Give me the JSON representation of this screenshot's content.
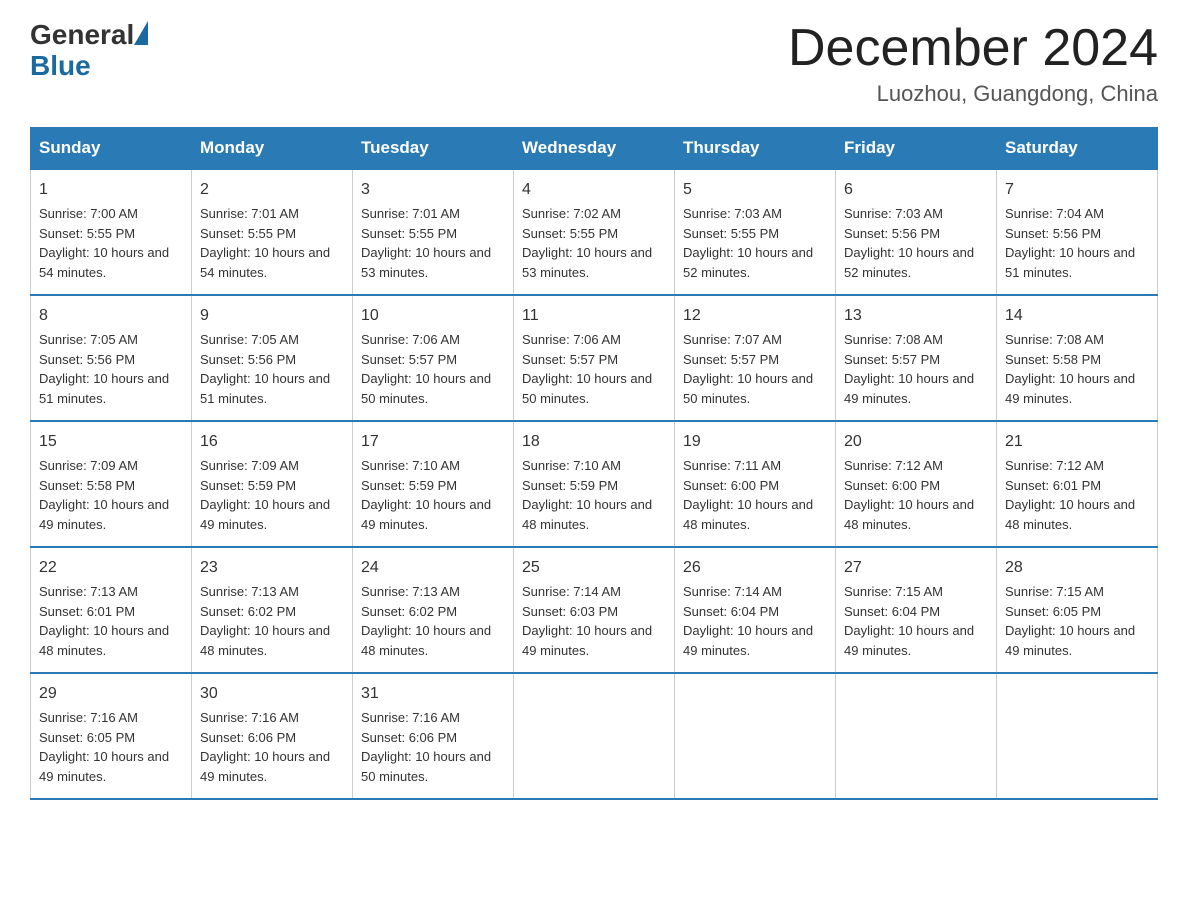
{
  "header": {
    "logo_general": "General",
    "logo_blue": "Blue",
    "month_title": "December 2024",
    "location": "Luozhou, Guangdong, China"
  },
  "days_of_week": [
    "Sunday",
    "Monday",
    "Tuesday",
    "Wednesday",
    "Thursday",
    "Friday",
    "Saturday"
  ],
  "weeks": [
    [
      {
        "day": "1",
        "sunrise": "7:00 AM",
        "sunset": "5:55 PM",
        "daylight": "10 hours and 54 minutes."
      },
      {
        "day": "2",
        "sunrise": "7:01 AM",
        "sunset": "5:55 PM",
        "daylight": "10 hours and 54 minutes."
      },
      {
        "day": "3",
        "sunrise": "7:01 AM",
        "sunset": "5:55 PM",
        "daylight": "10 hours and 53 minutes."
      },
      {
        "day": "4",
        "sunrise": "7:02 AM",
        "sunset": "5:55 PM",
        "daylight": "10 hours and 53 minutes."
      },
      {
        "day": "5",
        "sunrise": "7:03 AM",
        "sunset": "5:55 PM",
        "daylight": "10 hours and 52 minutes."
      },
      {
        "day": "6",
        "sunrise": "7:03 AM",
        "sunset": "5:56 PM",
        "daylight": "10 hours and 52 minutes."
      },
      {
        "day": "7",
        "sunrise": "7:04 AM",
        "sunset": "5:56 PM",
        "daylight": "10 hours and 51 minutes."
      }
    ],
    [
      {
        "day": "8",
        "sunrise": "7:05 AM",
        "sunset": "5:56 PM",
        "daylight": "10 hours and 51 minutes."
      },
      {
        "day": "9",
        "sunrise": "7:05 AM",
        "sunset": "5:56 PM",
        "daylight": "10 hours and 51 minutes."
      },
      {
        "day": "10",
        "sunrise": "7:06 AM",
        "sunset": "5:57 PM",
        "daylight": "10 hours and 50 minutes."
      },
      {
        "day": "11",
        "sunrise": "7:06 AM",
        "sunset": "5:57 PM",
        "daylight": "10 hours and 50 minutes."
      },
      {
        "day": "12",
        "sunrise": "7:07 AM",
        "sunset": "5:57 PM",
        "daylight": "10 hours and 50 minutes."
      },
      {
        "day": "13",
        "sunrise": "7:08 AM",
        "sunset": "5:57 PM",
        "daylight": "10 hours and 49 minutes."
      },
      {
        "day": "14",
        "sunrise": "7:08 AM",
        "sunset": "5:58 PM",
        "daylight": "10 hours and 49 minutes."
      }
    ],
    [
      {
        "day": "15",
        "sunrise": "7:09 AM",
        "sunset": "5:58 PM",
        "daylight": "10 hours and 49 minutes."
      },
      {
        "day": "16",
        "sunrise": "7:09 AM",
        "sunset": "5:59 PM",
        "daylight": "10 hours and 49 minutes."
      },
      {
        "day": "17",
        "sunrise": "7:10 AM",
        "sunset": "5:59 PM",
        "daylight": "10 hours and 49 minutes."
      },
      {
        "day": "18",
        "sunrise": "7:10 AM",
        "sunset": "5:59 PM",
        "daylight": "10 hours and 48 minutes."
      },
      {
        "day": "19",
        "sunrise": "7:11 AM",
        "sunset": "6:00 PM",
        "daylight": "10 hours and 48 minutes."
      },
      {
        "day": "20",
        "sunrise": "7:12 AM",
        "sunset": "6:00 PM",
        "daylight": "10 hours and 48 minutes."
      },
      {
        "day": "21",
        "sunrise": "7:12 AM",
        "sunset": "6:01 PM",
        "daylight": "10 hours and 48 minutes."
      }
    ],
    [
      {
        "day": "22",
        "sunrise": "7:13 AM",
        "sunset": "6:01 PM",
        "daylight": "10 hours and 48 minutes."
      },
      {
        "day": "23",
        "sunrise": "7:13 AM",
        "sunset": "6:02 PM",
        "daylight": "10 hours and 48 minutes."
      },
      {
        "day": "24",
        "sunrise": "7:13 AM",
        "sunset": "6:02 PM",
        "daylight": "10 hours and 48 minutes."
      },
      {
        "day": "25",
        "sunrise": "7:14 AM",
        "sunset": "6:03 PM",
        "daylight": "10 hours and 49 minutes."
      },
      {
        "day": "26",
        "sunrise": "7:14 AM",
        "sunset": "6:04 PM",
        "daylight": "10 hours and 49 minutes."
      },
      {
        "day": "27",
        "sunrise": "7:15 AM",
        "sunset": "6:04 PM",
        "daylight": "10 hours and 49 minutes."
      },
      {
        "day": "28",
        "sunrise": "7:15 AM",
        "sunset": "6:05 PM",
        "daylight": "10 hours and 49 minutes."
      }
    ],
    [
      {
        "day": "29",
        "sunrise": "7:16 AM",
        "sunset": "6:05 PM",
        "daylight": "10 hours and 49 minutes."
      },
      {
        "day": "30",
        "sunrise": "7:16 AM",
        "sunset": "6:06 PM",
        "daylight": "10 hours and 49 minutes."
      },
      {
        "day": "31",
        "sunrise": "7:16 AM",
        "sunset": "6:06 PM",
        "daylight": "10 hours and 50 minutes."
      },
      null,
      null,
      null,
      null
    ]
  ]
}
